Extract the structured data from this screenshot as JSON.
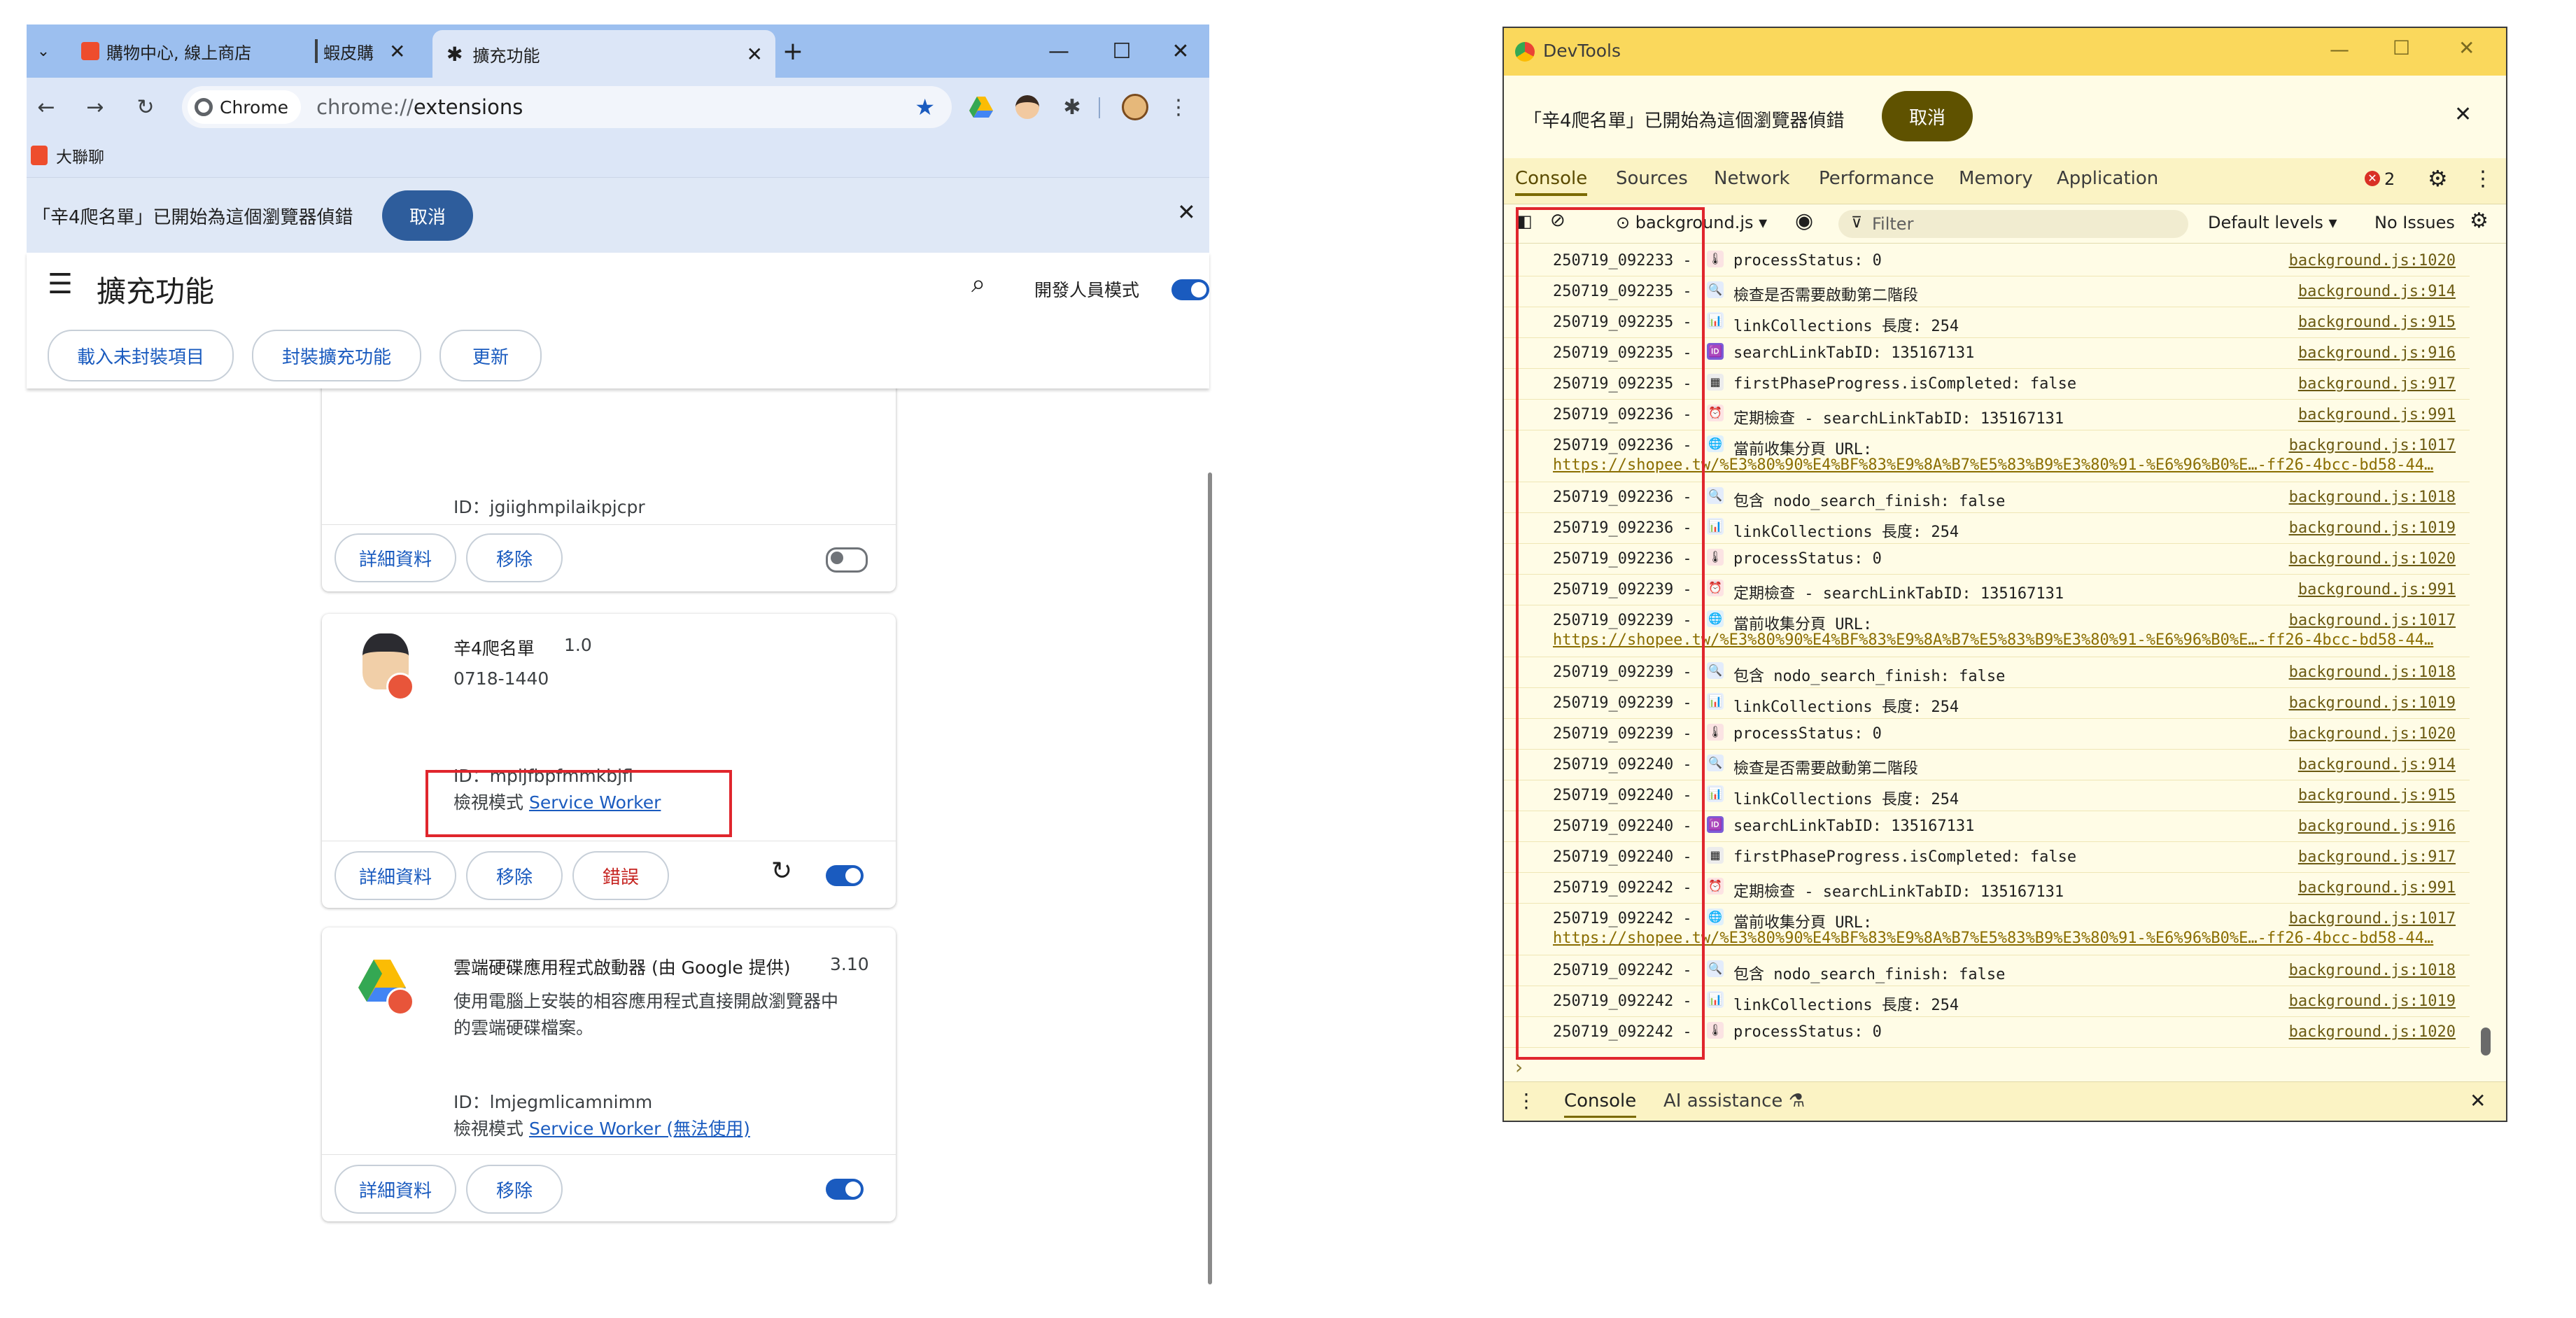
{
  "browser": {
    "tabs": [
      {
        "label": "購物中心, 線上商店"
      },
      {
        "label": "蝦皮購"
      },
      {
        "label": "擴充功能"
      }
    ],
    "new_tab": "+",
    "omnibox": {
      "chip": "Chrome",
      "url_prefix": "chrome://",
      "url_host": "extensions"
    },
    "bookmark": "大聯聊",
    "infobar_text": "「辛4爬名單」已開始為這個瀏覽器偵錯",
    "infobar_cancel": "取消"
  },
  "extensions": {
    "title": "擴充功能",
    "dev_mode_label": "開發人員模式",
    "buttons": [
      "載入未封裝項目",
      "封裝擴充功能",
      "更新"
    ],
    "cards": [
      {
        "id_text": "ID：jgiighmpilaikpjcpr",
        "details": "詳細資料",
        "remove": "移除"
      },
      {
        "name": "辛4爬名單",
        "version": "1.0",
        "desc": "0718-1440",
        "id_text": "ID：mpijfbpfmmkbjfl",
        "inspect_label": "檢視模式",
        "inspect_link": "Service Worker",
        "details": "詳細資料",
        "remove": "移除",
        "errors": "錯誤"
      },
      {
        "name": "雲端硬碟應用程式啟動器 (由 Google 提供)",
        "version": "3.10",
        "desc_line1": "使用電腦上安裝的相容應用程式直接開啟瀏覽器中",
        "desc_line2": "的雲端硬碟檔案。",
        "id_text": "ID：lmjegmlicamnimm",
        "inspect_label": "檢視模式",
        "inspect_link": "Service Worker (無法使用)",
        "details": "詳細資料",
        "remove": "移除"
      }
    ]
  },
  "devtools": {
    "title": "DevTools",
    "infobar_text": "「辛4爬名單」已開始為這個瀏覽器偵錯",
    "infobar_cancel": "取消",
    "tabs": [
      "Console",
      "Sources",
      "Network",
      "Performance",
      "Memory",
      "Application"
    ],
    "error_count": "2",
    "context": "background.js ▾",
    "filter_placeholder": "Filter",
    "levels": "Default levels ▾",
    "issues": "No Issues",
    "bottom_tabs": [
      "Console",
      "AI assistance"
    ],
    "rows": [
      {
        "ts": "250719_092233 -",
        "icon": "🌡",
        "msg": "processStatus: 0",
        "src": "background.js:1020",
        "url": ""
      },
      {
        "ts": "250719_092235 -",
        "icon": "🔍",
        "msg": "檢查是否需要啟動第二階段",
        "src": "background.js:914",
        "url": ""
      },
      {
        "ts": "250719_092235 -",
        "icon": "📊",
        "msg": "linkCollections 長度: 254",
        "src": "background.js:915",
        "url": ""
      },
      {
        "ts": "250719_092235 -",
        "icon": "🆔",
        "msg": "searchLinkTabID: 135167131",
        "src": "background.js:916",
        "url": ""
      },
      {
        "ts": "250719_092235 -",
        "icon": "▦",
        "msg": "firstPhaseProgress.isCompleted: false",
        "src": "background.js:917",
        "url": ""
      },
      {
        "ts": "250719_092236 -",
        "icon": "⏰",
        "msg": "定期檢查 - searchLinkTabID: 135167131",
        "src": "background.js:991",
        "url": ""
      },
      {
        "ts": "250719_092236 -",
        "icon": "🌐",
        "msg": "當前收集分頁 URL:",
        "src": "background.js:1017",
        "url": "https://shopee.tw/%E3%80%90%E4%BF%83%E9%8A%B7%E5%83%B9%E3%80%91-%E6%96%B0%E…-ff26-4bcc-bd58-44…"
      },
      {
        "ts": "250719_092236 -",
        "icon": "🔍",
        "msg": "包含 nodo_search_finish: false",
        "src": "background.js:1018",
        "url": ""
      },
      {
        "ts": "250719_092236 -",
        "icon": "📊",
        "msg": "linkCollections 長度: 254",
        "src": "background.js:1019",
        "url": ""
      },
      {
        "ts": "250719_092236 -",
        "icon": "🌡",
        "msg": "processStatus: 0",
        "src": "background.js:1020",
        "url": ""
      },
      {
        "ts": "250719_092239 -",
        "icon": "⏰",
        "msg": "定期檢查 - searchLinkTabID: 135167131",
        "src": "background.js:991",
        "url": ""
      },
      {
        "ts": "250719_092239 -",
        "icon": "🌐",
        "msg": "當前收集分頁 URL:",
        "src": "background.js:1017",
        "url": "https://shopee.tw/%E3%80%90%E4%BF%83%E9%8A%B7%E5%83%B9%E3%80%91-%E6%96%B0%E…-ff26-4bcc-bd58-44…"
      },
      {
        "ts": "250719_092239 -",
        "icon": "🔍",
        "msg": "包含 nodo_search_finish: false",
        "src": "background.js:1018",
        "url": ""
      },
      {
        "ts": "250719_092239 -",
        "icon": "📊",
        "msg": "linkCollections 長度: 254",
        "src": "background.js:1019",
        "url": ""
      },
      {
        "ts": "250719_092239 -",
        "icon": "🌡",
        "msg": "processStatus: 0",
        "src": "background.js:1020",
        "url": ""
      },
      {
        "ts": "250719_092240 -",
        "icon": "🔍",
        "msg": "檢查是否需要啟動第二階段",
        "src": "background.js:914",
        "url": ""
      },
      {
        "ts": "250719_092240 -",
        "icon": "📊",
        "msg": "linkCollections 長度: 254",
        "src": "background.js:915",
        "url": ""
      },
      {
        "ts": "250719_092240 -",
        "icon": "🆔",
        "msg": "searchLinkTabID: 135167131",
        "src": "background.js:916",
        "url": ""
      },
      {
        "ts": "250719_092240 -",
        "icon": "▦",
        "msg": "firstPhaseProgress.isCompleted: false",
        "src": "background.js:917",
        "url": ""
      },
      {
        "ts": "250719_092242 -",
        "icon": "⏰",
        "msg": "定期檢查 - searchLinkTabID: 135167131",
        "src": "background.js:991",
        "url": ""
      },
      {
        "ts": "250719_092242 -",
        "icon": "🌐",
        "msg": "當前收集分頁 URL:",
        "src": "background.js:1017",
        "url": "https://shopee.tw/%E3%80%90%E4%BF%83%E9%8A%B7%E5%83%B9%E3%80%91-%E6%96%B0%E…-ff26-4bcc-bd58-44…"
      },
      {
        "ts": "250719_092242 -",
        "icon": "🔍",
        "msg": "包含 nodo_search_finish: false",
        "src": "background.js:1018",
        "url": ""
      },
      {
        "ts": "250719_092242 -",
        "icon": "📊",
        "msg": "linkCollections 長度: 254",
        "src": "background.js:1019",
        "url": ""
      },
      {
        "ts": "250719_092242 -",
        "icon": "🌡",
        "msg": "processStatus: 0",
        "src": "background.js:1020",
        "url": ""
      }
    ],
    "prompt": "›"
  },
  "colors": {
    "accent": "#1a5bbf",
    "devtools_title": "#fad85c",
    "highlight": "#e0262d"
  }
}
